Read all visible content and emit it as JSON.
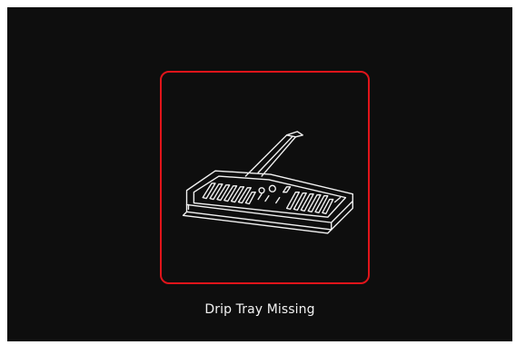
{
  "alert": {
    "message": "Drip Tray Missing",
    "icon": "drip-tray-icon",
    "frame_color": "#e0141a",
    "background_color": "#0e0e0e",
    "text_color": "#f2f2f2"
  }
}
